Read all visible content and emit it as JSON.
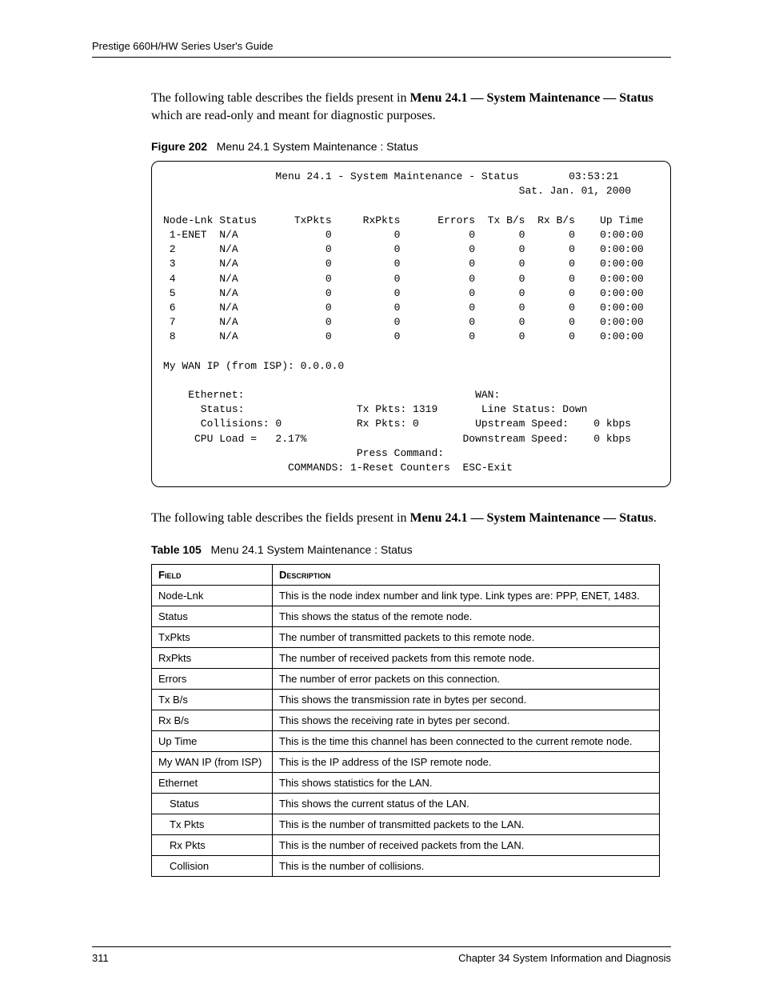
{
  "header": {
    "running": "Prestige 660H/HW Series User's Guide"
  },
  "paras": {
    "intro1_a": "The following table describes the fields present in ",
    "intro1_b": "Menu 24.1 — System Maintenance — Status",
    "intro1_c": " which are read-only and meant for diagnostic purposes.",
    "intro2_a": "The following table describes the fields present in ",
    "intro2_b": "Menu 24.1 — System Maintenance — Status",
    "intro2_c": "."
  },
  "figure": {
    "label": "Figure 202",
    "caption": "Menu 24.1 System Maintenance : Status"
  },
  "terminal": {
    "line1": "                  Menu 24.1 - System Maintenance - Status        03:53:21",
    "line2": "                                                         Sat. Jan. 01, 2000",
    "line3": "",
    "line4": "Node-Lnk Status      TxPkts     RxPkts      Errors  Tx B/s  Rx B/s    Up Time",
    "line5": " 1-ENET  N/A              0          0           0       0       0    0:00:00",
    "line6": " 2       N/A              0          0           0       0       0    0:00:00",
    "line7": " 3       N/A              0          0           0       0       0    0:00:00",
    "line8": " 4       N/A              0          0           0       0       0    0:00:00",
    "line9": " 5       N/A              0          0           0       0       0    0:00:00",
    "line10": " 6       N/A              0          0           0       0       0    0:00:00",
    "line11": " 7       N/A              0          0           0       0       0    0:00:00",
    "line12": " 8       N/A              0          0           0       0       0    0:00:00",
    "line13": "",
    "line14": "My WAN IP (from ISP): 0.0.0.0",
    "line15": "",
    "line16": "    Ethernet:                                     WAN:",
    "line17": "      Status:                  Tx Pkts: 1319       Line Status: Down",
    "line18": "      Collisions: 0            Rx Pkts: 0         Upstream Speed:    0 kbps",
    "line19": "     CPU Load =   2.17%                         Downstream Speed:    0 kbps",
    "line20": "                               Press Command:",
    "line21": "                    COMMANDS: 1-Reset Counters  ESC-Exit"
  },
  "table": {
    "label": "Table 105",
    "caption": "Menu 24.1 System Maintenance : Status",
    "headers": {
      "field": "Field",
      "desc": "Description"
    },
    "rows": [
      {
        "field": "Node-Lnk",
        "indent": false,
        "desc": "This is the node index number and link type. Link types are: PPP, ENET, 1483."
      },
      {
        "field": "Status",
        "indent": false,
        "desc": "This shows the status of the remote node."
      },
      {
        "field": "TxPkts",
        "indent": false,
        "desc": "The number of transmitted packets to this remote node."
      },
      {
        "field": "RxPkts",
        "indent": false,
        "desc": "The number of received packets from this remote node."
      },
      {
        "field": "Errors",
        "indent": false,
        "desc": "The number of error packets on this connection."
      },
      {
        "field": "Tx B/s",
        "indent": false,
        "desc": "This shows the transmission rate in bytes per second."
      },
      {
        "field": "Rx B/s",
        "indent": false,
        "desc": "This shows the receiving rate in bytes per second."
      },
      {
        "field": "Up Time",
        "indent": false,
        "desc": "This is the time this channel has been connected to the current remote node."
      },
      {
        "field": "My WAN IP (from ISP)",
        "indent": false,
        "desc": "This is the IP address of the ISP remote node."
      },
      {
        "field": "Ethernet",
        "indent": false,
        "desc": "This shows statistics for the LAN."
      },
      {
        "field": "Status",
        "indent": true,
        "desc": "This shows the current status of the LAN."
      },
      {
        "field": "Tx Pkts",
        "indent": true,
        "desc": "This is the number of transmitted packets to the LAN."
      },
      {
        "field": "Rx Pkts",
        "indent": true,
        "desc": "This is the number of received packets from the LAN."
      },
      {
        "field": "Collision",
        "indent": true,
        "desc": "This is the number of collisions."
      }
    ]
  },
  "footer": {
    "page": "311",
    "chapter": "Chapter 34 System Information and Diagnosis"
  }
}
